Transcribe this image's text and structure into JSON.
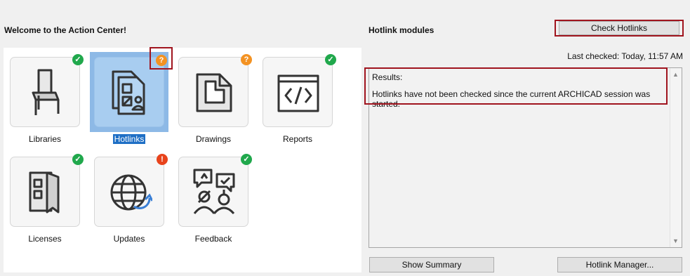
{
  "left": {
    "title": "Welcome to the Action Center!"
  },
  "tiles": [
    {
      "label": "Libraries",
      "icon": "chair-icon",
      "status": "ok"
    },
    {
      "label": "Hotlinks",
      "icon": "hotlinks-icon",
      "status": "warning",
      "selected": true
    },
    {
      "label": "Drawings",
      "icon": "drawings-icon",
      "status": "warning"
    },
    {
      "label": "Reports",
      "icon": "code-icon",
      "status": "ok"
    },
    {
      "label": "Licenses",
      "icon": "licenses-icon",
      "status": "ok"
    },
    {
      "label": "Updates",
      "icon": "globe-update-icon",
      "status": "error"
    },
    {
      "label": "Feedback",
      "icon": "feedback-icon",
      "status": "ok"
    }
  ],
  "badges": {
    "ok": "✓",
    "warning": "?",
    "error": "!"
  },
  "right": {
    "title": "Hotlink modules",
    "check_button": "Check Hotlinks",
    "last_checked": "Last checked: Today, 11:57 AM",
    "results_heading": "Results:",
    "results_text": "Hotlinks have not been checked since the current ARCHICAD session was started.",
    "show_summary_button": "Show Summary",
    "hotlink_manager_button": "Hotlink Manager..."
  },
  "colors": {
    "selected": "#8db9e6",
    "ok": "#20a84c",
    "warning": "#f39222",
    "error": "#e8431b",
    "highlight_box": "#a0141e"
  }
}
